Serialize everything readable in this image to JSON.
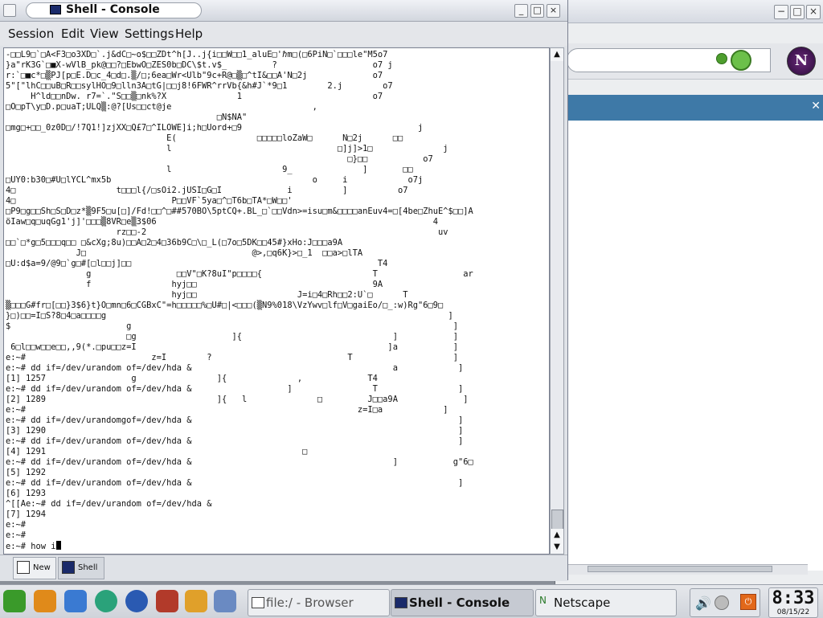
{
  "console": {
    "title": "Shell - Console",
    "menu": [
      "Session",
      "Edit",
      "View",
      "Settings",
      "Help"
    ],
    "terminal_lines": [
      "-□□L9□`□A<F3□o3XD□`.j&dC□~o$□□ZDt^h[J..j{i□□W□□1_aluE□'ℏm□(□6PiN□`□□□le\"M5o7",
      "}a\"rK3G`□■X-wVlB_pk@□□?□EbwO□ZES0b□DC\\$t.v$_         ?                   o7 j",
      "r:`□■c*□▒PJ[p□E.D□c_4□d□.▒/□;6ea□Wr<Ulb\"9c+R@□▒□^tI&□□A'N□2j             o7",
      "5\"[\"lhC□□uB□R□□sylHO□9□lln3A□tG|□□j8!6FWR^rrVb{&h#J`*9□1        2.j        o7",
      "     H^ld□□nDw. r7=`.\"S□□▒□nk%?X              1                          o7",
      "□O□pT\\y□D.p□uaT;ULQ▒:@?[Us□□ct@je                            ,",
      "                                          □N$NA\"",
      "□mg□+□□_0z0D□/!7Q1!]zjXX□Q£7□^ILOWE]i;h□Uord+□9                                   j",
      "                                E(                □□□□□loZaW□      N□2j      □□",
      "                                l                                 □]j]>1□              j",
      "                                                                    □}□□           o7",
      "                                l                      9_              ]       □□",
      "□UY0:b30□#U□lYCL^mx5b                                        o     i            o7j",
      "4□                    t□□□l{/□sOi2.jUSI□G□I             i          ]          o7",
      "4□                               P□□VF`5ya□^□T6b□TA*□W□□'",
      "□P9□g□□Sh□S□D□z*▒9F5□u[□]/Fd!□□^□##570BO\\5ptCQ+.BL_□`□□Vdn>=isu□m&□□□□anEuv4=□[4be□ZhuE^$□□]A",
      "öIaw□q□uqGg1'j]'□□□▒8VR□e▒3$06                                                       4",
      "                      rz□□-2                                                          uv",
      "□□`□*g□5□□□q□□ □&cXg;8u)□□A□2□4□36b9C□\\□_L(□7o□5DK□□45#}xHo:J□□□a9A",
      "              J□                                 @>,□q6K}>□_1  □□a>□lTA",
      "□U:d$a=9/@9□`g□#[□l□□j]□□                                                 T4",
      "                g                 □□V\"□K?8uI\"p□□□□{                      T                 ar",
      "                f                hyj□□                                   9A",
      "                                 hyj□□                    J=i□4□Rh□□2:U`□      T",
      "▒□□□G#fr□[□□}3$6}t}O□mn□6□CGBxC\"=h□□□□□%□U#□|<□□□(▒N9%018\\VzYwv□lf□V□gaiEo/□_:w)Rg\"6□9□",
      "}□)□□=I□S?8□4□a□□□□g                                                                    ]",
      "$                       g                                                                ]",
      "                        □g                   ]{                              ]           ]",
      " 6□l□□w□□e□□,,9(*.□pu□□z=I                                                  ]a           ]",
      "e:~#                         z=I        ?                           T                    ]",
      "e:~# dd if=/dev/urandom of=/dev/hda &                                        a            ]",
      "[1] 1257                 g                ]{              ,             T4",
      "e:~# dd if=/dev/urandom of=/dev/hda &                   ]                T                ]",
      "[2] 1289                                  ]{   l              □         J□□a9A             ]",
      "e:~#                                                                  z=I□a            ]",
      "e:~# dd if=/dev/urandomgof=/dev/hda &                                                     ]",
      "[3] 1290                                                                                  ]",
      "e:~# dd if=/dev/urandom of=/dev/hda &                                                     ]",
      "[4] 1291                                                   □",
      "e:~# dd if=/dev/urandom of=/dev/hda &                                        ]           g\"6□",
      "[5] 1292",
      "e:~# dd if=/dev/urandom of=/dev/hda &                                                     ]",
      "[6] 1293",
      "^[[Ae:~# dd if=/dev/urandom of=/dev/hda &",
      "[7] 1294",
      "e:~#",
      "e:~#"
    ],
    "prompt_line": "e:~# how i",
    "tabs": [
      {
        "label": "New"
      },
      {
        "label": "Shell"
      }
    ]
  },
  "browser_bg": {
    "logo": "N"
  },
  "taskbar": {
    "tasks": [
      {
        "label": "file:/ - Browser"
      },
      {
        "label": "Shell - Console"
      },
      {
        "label": "Netscape"
      }
    ],
    "clock_time": "8:33",
    "clock_date": "08/15/22"
  }
}
